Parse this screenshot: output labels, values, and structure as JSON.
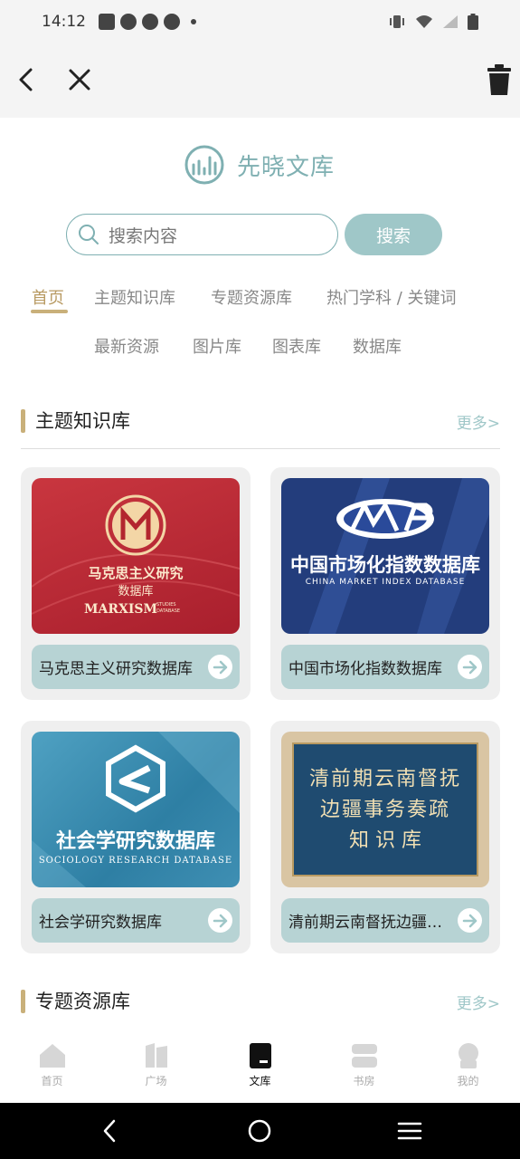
{
  "status": {
    "time": "14:12"
  },
  "logo": {
    "text": "先晓文库"
  },
  "search": {
    "placeholder": "搜索内容",
    "button": "搜索"
  },
  "tabs": [
    "首页",
    "主题知识库",
    "专题资源库",
    "热门学科 / 关键词",
    "最新资源",
    "图片库",
    "图表库",
    "数据库"
  ],
  "sections": [
    {
      "title": "主题知识库",
      "more": "更多>"
    },
    {
      "title": "专题资源库",
      "more": "更多>"
    }
  ],
  "cards": [
    {
      "label": "马克思主义研究数据库",
      "img": {
        "title1": "马克思主义研究",
        "title2": "数据库",
        "en1": "MARXISM",
        "en2": "STUDIES",
        "en3": "DATABASE"
      }
    },
    {
      "label": "中国市场化指数数据库",
      "img": {
        "title": "中国市场化指数数据库",
        "en": "CHINA MARKET INDEX DATABASE"
      }
    },
    {
      "label": "社会学研究数据库",
      "img": {
        "title": "社会学研究数据库",
        "en": "SOCIOLOGY RESEARCH DATABASE"
      }
    },
    {
      "label": "清前期云南督抚边疆事务奏疏知识库",
      "img": {
        "line1": "清前期云南督抚",
        "line2": "边疆事务奏疏",
        "line3": "知 识 库"
      }
    }
  ],
  "bottom_nav": [
    {
      "label": "首页",
      "icon": "home-icon"
    },
    {
      "label": "广场",
      "icon": "square-icon"
    },
    {
      "label": "文库",
      "icon": "library-icon"
    },
    {
      "label": "书房",
      "icon": "study-icon"
    },
    {
      "label": "我的",
      "icon": "profile-icon"
    }
  ],
  "colors": {
    "accent": "#9fc7c8",
    "gold": "#c9b07a",
    "active_tab": "#b89a62"
  }
}
